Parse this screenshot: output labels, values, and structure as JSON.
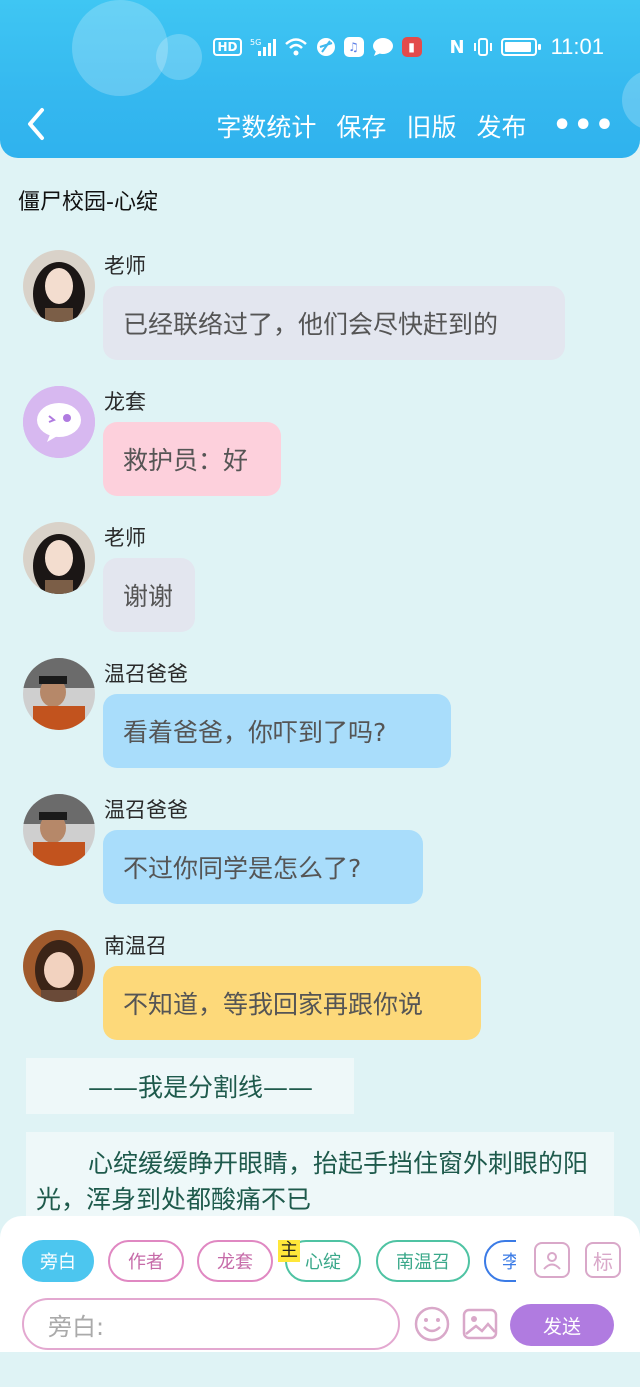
{
  "status_bar": {
    "hd": "HD",
    "signal": "5G",
    "time": "11:01"
  },
  "nav": {
    "word_count": "字数统计",
    "save": "保存",
    "old_version": "旧版",
    "publish": "发布",
    "more": "•••"
  },
  "story_title": "僵尸校园-心绽",
  "messages": [
    {
      "name": "老师",
      "text": "已经联络过了，他们会尽快赶到的"
    },
    {
      "name": "龙套",
      "text": "救护员：好"
    },
    {
      "name": "老师",
      "text": "谢谢"
    },
    {
      "name": "温召爸爸",
      "text": "看着爸爸，你吓到了吗?"
    },
    {
      "name": "温召爸爸",
      "text": "不过你同学是怎么了?"
    },
    {
      "name": "南温召",
      "text": "不知道，等我回家再跟你说"
    }
  ],
  "narration": [
    "——我是分割线——",
    "心绽缓缓睁开眼睛，抬起手挡住窗外刺眼的阳光，浑身到处都酸痛不已"
  ],
  "roles": {
    "narrator": "旁白",
    "author": "作者",
    "extra": "龙套",
    "main_badge": "主",
    "xinzhan": "心绽",
    "nanwenzhao": "南温召",
    "li": "李"
  },
  "tools": {
    "mark": "标"
  },
  "composer": {
    "placeholder": "旁白:",
    "send": "发送"
  },
  "colors": {
    "header": "#3fc6f3",
    "teacher_bubble": "#e3e6ef",
    "extra_bubble": "#fdd0dc",
    "father_bubble": "#a9ddfb",
    "nan_bubble": "#fdd97a",
    "send": "#b07be0"
  }
}
